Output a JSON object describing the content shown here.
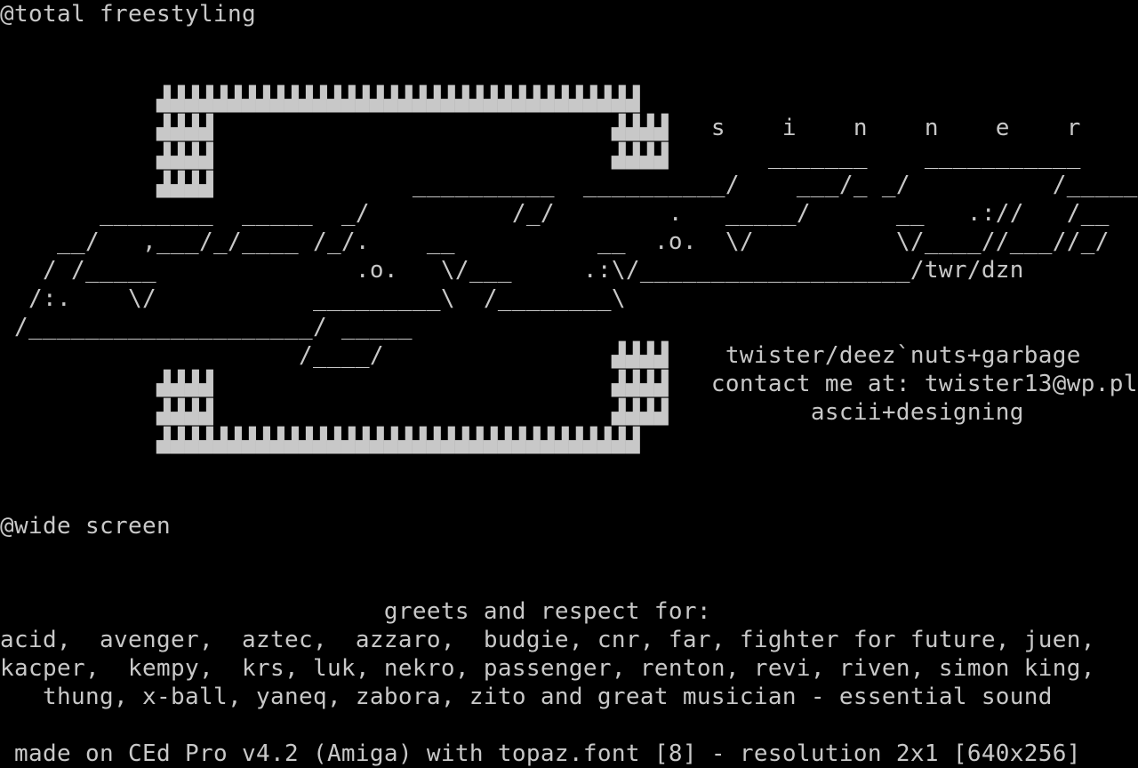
{
  "screen": {
    "background_color": "#000000",
    "text_color": "#c8c8c8",
    "columns": 80,
    "lines": [
      "@total freestyling",
      "",
      "",
      "           ▟▟▟▟▟▟▟▟▟▟▟▟▟▟▟▟▟▟▟▟▟▟▟▟▟▟▟▟▟▟▟▟▟▟",
      "           ▟▟▟▟                            ▟▟▟▟   s    i    n    n    e    r",
      "           ▟▟▟▟                            ▟▟▟▟       _______    ___________",
      "           ▟▟▟▟              __________  __________/    ___/_ _/          /_____",
      "       ________  _____  _/          /_/        .   _____/      __   .://   /__",
      "    __/   ,___/_/____ /_/.    __          __  .o.  \\/          \\/____//___//_/",
      "   / /_____              .o.   \\/___     .:\\/___________________/twr/dzn",
      "  /:.    \\/           _________\\  /________\\",
      " /____________________/ _____",
      "                     /____/                ▟▟▟▟    twister/deez`nuts+garbage",
      "           ▟▟▟▟                            ▟▟▟▟   contact me at: twister13@wp.pl",
      "           ▟▟▟▟                            ▟▟▟▟          ascii+designing",
      "           ▟▟▟▟▟▟▟▟▟▟▟▟▟▟▟▟▟▟▟▟▟▟▟▟▟▟▟▟▟▟▟▟▟▟",
      "",
      "",
      "@wide screen",
      "",
      "",
      "                           greets and respect for:",
      "acid,  avenger,  aztec,  azzaro,  budgie, cnr, far, fighter for future, juen,",
      "kacper,  kempy,  krs, luk, nekro, passenger, renton, revi, riven, simon king,",
      "   thung, x-ball, yaneq, zabora, zito and great musician - essential sound",
      "",
      " made on CEd Pro v4.2 (Amiga) with topaz.font [8] - resolution 2x1 [640x256]"
    ]
  }
}
